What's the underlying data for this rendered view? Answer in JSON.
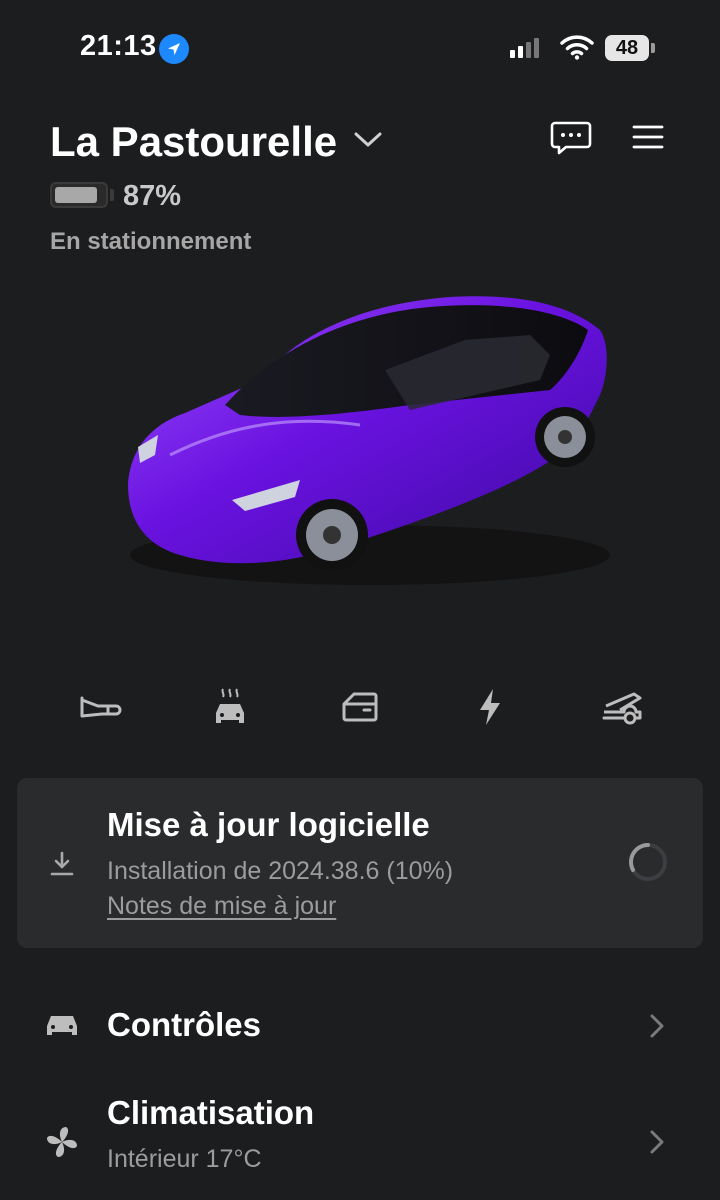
{
  "status_bar": {
    "time": "21:13",
    "battery": "48"
  },
  "vehicle": {
    "name": "La Pastourelle",
    "battery_percent": "87%",
    "battery_level": 0.87,
    "state": "En stationnement",
    "paint_color": "#7a1ff0"
  },
  "quick_actions": [
    {
      "icon": "horn-icon"
    },
    {
      "icon": "defrost-car-icon"
    },
    {
      "icon": "car-door-icon"
    },
    {
      "icon": "charging-bolt-icon"
    },
    {
      "icon": "trunk-open-icon"
    }
  ],
  "software_update": {
    "title": "Mise à jour logicielle",
    "subtitle": "Installation de 2024.38.6 (10%)",
    "progress": 0.1,
    "link": "Notes de mise à jour"
  },
  "menu": [
    {
      "title": "Contrôles",
      "icon": "car-icon"
    },
    {
      "title": "Climatisation",
      "subtitle": "Intérieur 17°C",
      "icon": "fan-icon"
    }
  ],
  "colors": {
    "background": "#1c1d1f",
    "card": "#2a2b2d",
    "accent_location": "#1e88ff"
  }
}
